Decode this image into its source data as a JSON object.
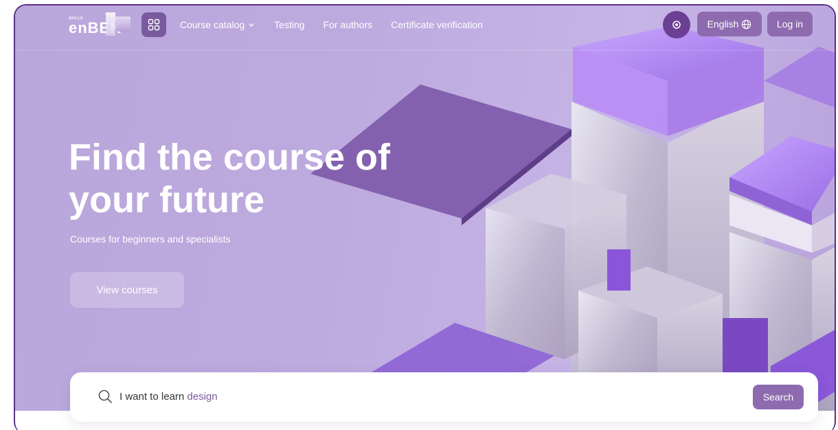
{
  "header": {
    "logo_small": "SKILLS",
    "logo_main": "enBEK",
    "nav": [
      {
        "label": "Course catalog",
        "has_dropdown": true
      },
      {
        "label": "Testing"
      },
      {
        "label": "For authors"
      },
      {
        "label": "Certificate verification"
      }
    ],
    "language_label": "English",
    "login_label": "Log in"
  },
  "hero": {
    "title": "Find the course of your future",
    "subtitle": "Courses for beginners and specialists",
    "cta_label": "View courses"
  },
  "search": {
    "prefix": "I want to learn ",
    "highlight": "design",
    "button_label": "Search"
  },
  "icons": [
    "apps-grid-icon",
    "chevron-down-icon",
    "eye-icon",
    "globe-icon",
    "search-icon"
  ],
  "colors": {
    "accent": "#8e6bae",
    "dark_accent": "#6b3f93",
    "frame_border": "#5b2e86",
    "hero_bg": "#bdaadf"
  }
}
